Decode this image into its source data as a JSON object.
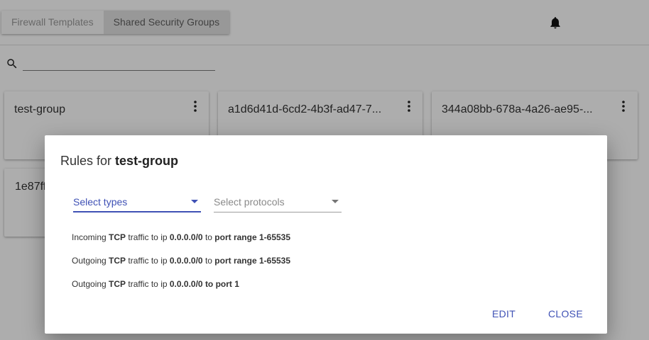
{
  "tabs": [
    {
      "label": "Firewall Templates",
      "active": false
    },
    {
      "label": "Shared Security Groups",
      "active": true
    }
  ],
  "header": {
    "notification_icon": "bell-icon"
  },
  "search": {
    "icon": "search-icon",
    "value": ""
  },
  "cards": [
    {
      "title": "test-group"
    },
    {
      "title": "a1d6d41d-6cd2-4b3f-ad47-7..."
    },
    {
      "title": "344a08bb-678a-4a26-ae95-..."
    },
    {
      "title": "1e87ff"
    }
  ],
  "dialog": {
    "title_prefix": "Rules for",
    "title_name": "test-group",
    "select_types": {
      "placeholder": "Select types"
    },
    "select_protocols": {
      "placeholder": "Select protocols"
    },
    "rules": [
      {
        "direction": "Incoming",
        "protocol": "TCP",
        "mid": "traffic to ip",
        "ip": "0.0.0.0/0",
        "to": "to",
        "target": "port range 1-65535"
      },
      {
        "direction": "Outgoing",
        "protocol": "TCP",
        "mid": "traffic to ip",
        "ip": "0.0.0.0/0",
        "to": "to",
        "target": "port range 1-65535"
      },
      {
        "direction": "Outgoing",
        "protocol": "TCP",
        "mid": "traffic to ip",
        "ip": "0.0.0.0/0",
        "to": "to port 1",
        "target": ""
      }
    ],
    "edit_label": "EDIT",
    "close_label": "CLOSE"
  },
  "colors": {
    "accent": "#3f51b5",
    "overlay": "rgba(0,0,0,0.32)"
  }
}
